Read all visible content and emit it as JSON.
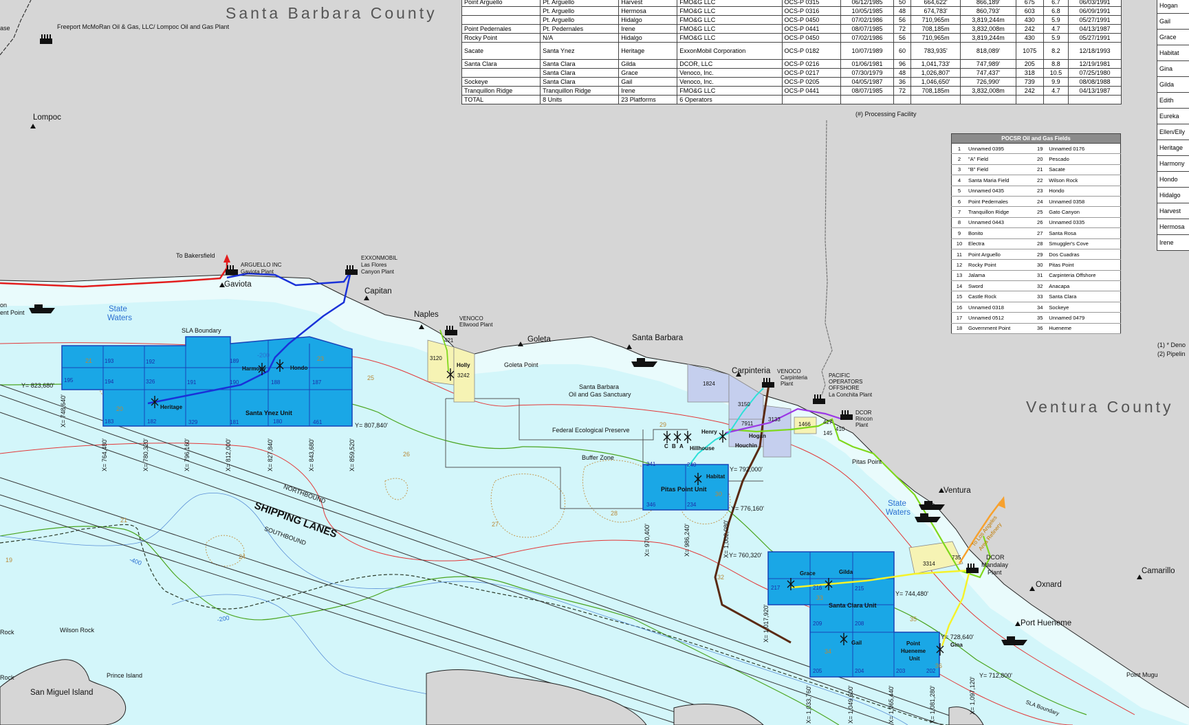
{
  "counties": {
    "santa_barbara": "Santa Barbara County",
    "ventura": "Ventura County"
  },
  "places": {
    "lompoc": "Lompoc",
    "gaviota": "Gaviota",
    "capitan": "Capitan",
    "naples": "Naples",
    "goleta": "Goleta",
    "santa_barbara": "Santa Barbara",
    "carpinteria": "Carpinteria",
    "ventura": "Ventura",
    "oxnard": "Oxnard",
    "camarillo": "Camarillo",
    "port_hueneme": "Port Hueneme",
    "point_mugu": "Point Mugu",
    "pitas_point": "Pitas Point",
    "goleta_point": "Goleta Point",
    "wilson_rock": "Wilson Rock",
    "prince_island": "Prince Island",
    "san_miguel_island": "San Miguel Island",
    "rock": "Rock",
    "conception_point": "ent Point",
    "base": "ase",
    "on": "on"
  },
  "facilities": {
    "freeport_plant": "Freeport McMoRan Oil & Gas, LLC/ Lompoc Oil and Gas Plant",
    "arguello_1": "ARGUELLO INC",
    "arguello_2": "Gaviota Plant",
    "exxon_1": "EXXONMOBIL",
    "exxon_2": "Las Flores",
    "exxon_3": "Canyon Plant",
    "venoco_ellwood_1": "VENOCO",
    "venoco_ellwood_2": "Ellwood Plant",
    "venoco_carp_1": "VENOCO",
    "venoco_carp_2": "Carpinteria",
    "venoco_carp_3": "Plant",
    "pacific_1": "PACIFIC",
    "pacific_2": "OPERATORS",
    "pacific_3": "OFFSHORE",
    "pacific_4": "La Conchita Plant",
    "dcor_rincon_1": "DCOR",
    "dcor_rincon_2": "Rincon",
    "dcor_rincon_3": "Plant",
    "dcor_mandalay_1": "DCOR",
    "dcor_mandalay_2": "Mandalay",
    "dcor_mandalay_3": "Plant",
    "to_bakersfield": "To Bakersfield",
    "to_la_1": "To Los Angeles",
    "to_la_2": "Area Refinery"
  },
  "zones": {
    "state_waters_1": "State",
    "state_waters_2": "Waters",
    "state_waters_b1": "State",
    "state_waters_b2": "Waters",
    "sla_boundary": "SLA Boundary",
    "sla_boundary_2": "SLA Boundary",
    "sanctuary_1": "Santa Barbara",
    "sanctuary_2": "Oil and Gas Sanctuary",
    "federal_preserve": "Federal Ecological Preserve",
    "buffer_zone": "Buffer Zone",
    "shipping_lanes": "SHIPPING LANES",
    "northbound": "NORTHBOUND",
    "southbound": "SOUTHBOUND"
  },
  "units": {
    "santa_ynez": "Santa Ynez Unit",
    "pitas_point": "Pitas Point Unit",
    "santa_clara": "Santa Clara Unit",
    "point_hueneme_1": "Point",
    "point_hueneme_2": "Hueneme",
    "point_hueneme_3": "Unit"
  },
  "platforms": {
    "heritage": "Heritage",
    "harmony": "Harmony",
    "hondo": "Hondo",
    "holly": "Holly",
    "henry": "Henry",
    "hillhouse": "Hillhouse",
    "houchin": "Houchin",
    "hogan": "Hogan",
    "habitat": "Habitat",
    "grace": "Grace",
    "gilda": "Gilda",
    "gail": "Gail",
    "gina": "Gina",
    "c": "C",
    "b": "B",
    "a": "A"
  },
  "tracts": {
    "t195": "195",
    "t193": "193",
    "t192": "192",
    "t194": "194",
    "t326": "326",
    "t191": "191",
    "t189": "189",
    "t190": "190",
    "t188": "188",
    "t187": "187",
    "t183": "183",
    "t182": "182",
    "t329": "329",
    "t181": "181",
    "t180": "180",
    "t461": "461",
    "t3120": "3120",
    "t3242": "3242",
    "t421": "421",
    "t1824": "1824",
    "t3150": "3150",
    "t3133": "3133",
    "t7911": "7911",
    "t1466": "1466",
    "t427": "427",
    "t410": "410",
    "t145": "145",
    "t241": "241",
    "t240": "240",
    "t346": "346",
    "t234": "234",
    "t3314": "3314",
    "t735": "735",
    "t217": "217",
    "t216": "216",
    "t215": "215",
    "t209": "209",
    "t208": "208",
    "t205": "205",
    "t204": "204",
    "t203": "203",
    "t202": "202"
  },
  "fields_nums": {
    "f20": "20",
    "f21": "21",
    "f23": "23",
    "f25": "25",
    "f26": "26",
    "f27": "27",
    "f28": "28",
    "f29": "29",
    "f30": "30",
    "f32": "32",
    "f33": "33",
    "f34": "34",
    "f35": "35",
    "f36": "36",
    "f19": "19",
    "f24": "24",
    "f21b": "21"
  },
  "depths": {
    "d400": "-400",
    "d200": "-200",
    "d200b": "-200"
  },
  "coords": {
    "y823680": "Y= 823,680'",
    "y807840": "Y= 807,840'",
    "y792000": "Y= 792,000'",
    "y776160": "Y= 776,160'",
    "y760320": "Y= 760,320'",
    "y744480": "Y= 744,480'",
    "y728640": "Y= 728,640'",
    "y712800": "Y= 712,800'",
    "x748640": "X= 748,640'",
    "x764480": "X= 764,480'",
    "x780320": "X= 780,320'",
    "x796160": "X= 796,160'",
    "x812000": "X= 812,000'",
    "x827840": "X= 827,840'",
    "x843680": "X= 843,680'",
    "x859520": "X= 859,520'",
    "x970400": "X= 970,400'",
    "x986240": "X= 986,240'",
    "x1002080": "X= 1,002,080'",
    "x1017920": "X= 1,017,920'",
    "x1033760": "X= 1,033,760'",
    "x1049600": "X= 1,049,600'",
    "x1065440": "X= 1,065,440'",
    "x1081280": "X= 1,081,280'",
    "x1097120": "X= 1,097,120'"
  },
  "platform_table": {
    "rows": [
      [
        "Point Arguello",
        "Pt. Arguello",
        "Harvest",
        "FMO&G LLC",
        "OCS-P 0315",
        "06/12/1985",
        "50",
        "664,622'",
        "866,189'",
        "675",
        "6.7",
        "06/03/1991"
      ],
      [
        "",
        "Pt. Arguello",
        "Hermosa",
        "FMO&G LLC",
        "OCS-P 0316",
        "10/05/1985",
        "48",
        "674,783'",
        "860,793'",
        "603",
        "6.8",
        "06/09/1991"
      ],
      [
        "",
        "Pt. Arguello",
        "Hidalgo",
        "FMO&G LLC",
        "OCS-P 0450",
        "07/02/1986",
        "56",
        "710,965m",
        "3,819,244m",
        "430",
        "5.9",
        "05/27/1991"
      ],
      [
        "Point Pedernales",
        "Pt. Pedernales",
        "Irene",
        "FMO&G LLC",
        "OCS-P 0441",
        "08/07/1985",
        "72",
        "708,185m",
        "3,832,008m",
        "242",
        "4.7",
        "04/13/1987"
      ],
      [
        "Rocky Point",
        "N/A",
        "Hidalgo",
        "FMO&G LLC",
        "OCS-P 0450",
        "07/02/1986",
        "56",
        "710,965m",
        "3,819,244m",
        "430",
        "5.9",
        "05/27/1991"
      ],
      [
        "Sacate",
        "Santa Ynez",
        "Heritage",
        "ExxonMobil Corporation",
        "OCS-P 0182",
        "10/07/1989",
        "60",
        "783,935'",
        "818,089'",
        "1075",
        "8.2",
        "12/18/1993"
      ],
      [
        "Santa Clara",
        "Santa Clara",
        "Gilda",
        "DCOR, LLC",
        "OCS-P 0216",
        "01/06/1981",
        "96",
        "1,041,733'",
        "747,989'",
        "205",
        "8.8",
        "12/19/1981"
      ],
      [
        "",
        "Santa Clara",
        "Grace",
        "Venoco, Inc.",
        "OCS-P 0217",
        "07/30/1979",
        "48",
        "1,026,807'",
        "747,437'",
        "318",
        "10.5",
        "07/25/1980"
      ],
      [
        "Sockeye",
        "Santa Clara",
        "Gail",
        "Venoco, Inc.",
        "OCS-P 0205",
        "04/05/1987",
        "36",
        "1,046,650'",
        "726,990'",
        "739",
        "9.9",
        "08/08/1988"
      ],
      [
        "Tranquillon Ridge",
        "Tranquillon Ridge",
        "Irene",
        "FMO&G LLC",
        "OCS-P 0441",
        "08/07/1985",
        "72",
        "708,185m",
        "3,832,008m",
        "242",
        "4.7",
        "04/13/1987"
      ],
      [
        "TOTAL",
        "8 Units",
        "23 Platforms",
        "6 Operators",
        "",
        "",
        "",
        "",
        "",
        "",
        "",
        ""
      ]
    ],
    "footnote": "(#) Processing Facility"
  },
  "fields_table": {
    "title": "POCSR Oil and Gas Fields",
    "rows": [
      [
        "1",
        "Unnamed 0395",
        "19",
        "Unnamed 0176"
      ],
      [
        "2",
        "\"A\" Field",
        "20",
        "Pescado"
      ],
      [
        "3",
        "\"B\" Field",
        "21",
        "Sacate"
      ],
      [
        "4",
        "Santa Maria Field",
        "22",
        "Wilson Rock"
      ],
      [
        "5",
        "Unnamed 0435",
        "23",
        "Hondo"
      ],
      [
        "6",
        "Point Pedernales",
        "24",
        "Unnamed 0358"
      ],
      [
        "7",
        "Tranquillon Ridge",
        "25",
        "Gato Canyon"
      ],
      [
        "8",
        "Unnamed 0443",
        "26",
        "Unnamed 0335"
      ],
      [
        "9",
        "Bonito",
        "27",
        "Santa Rosa"
      ],
      [
        "10",
        "Electra",
        "28",
        "Smuggler's Cove"
      ],
      [
        "11",
        "Point Arguello",
        "29",
        "Dos Cuadras"
      ],
      [
        "12",
        "Rocky Point",
        "30",
        "Pitas Point"
      ],
      [
        "13",
        "Jalama",
        "31",
        "Carpinteria Offshore"
      ],
      [
        "14",
        "Sword",
        "32",
        "Anacapa"
      ],
      [
        "15",
        "Castle Rock",
        "33",
        "Santa Clara"
      ],
      [
        "16",
        "Unnamed 0318",
        "34",
        "Sockeye"
      ],
      [
        "17",
        "Unnamed 0512",
        "35",
        "Unnamed 0479"
      ],
      [
        "18",
        "Government Point",
        "36",
        "Hueneme"
      ]
    ]
  },
  "right_table": {
    "rows": [
      "Hogan",
      "Gail",
      "Grace",
      "Habitat",
      "Gina",
      "Gilda",
      "Edith",
      "Eureka",
      "Ellen/Elly",
      "Heritage",
      "Harmony",
      "Hondo",
      "Hidalgo",
      "Harvest",
      "Hermosa",
      "Irene"
    ],
    "notes": [
      "(1) * Deno",
      "(2) Pipelin"
    ]
  },
  "colors": {
    "land": "#d6d6d6",
    "water": "#d3f6fa",
    "unit_fill": "#1aa7e6",
    "unit_border": "#1844b8",
    "state_waters": "#e9fbfc",
    "oil_pipeline_red": "#e21d1d",
    "gas_pipeline_blue": "#1a32d8",
    "pipeline_brown": "#5a2a12",
    "pipeline_green": "#7fd81c",
    "pipeline_yellow": "#f5f22a",
    "pipeline_purple": "#9b38e6",
    "pipeline_cyan": "#2ee0d8",
    "pipeline_orange": "#f7a12e",
    "sanctuary_tract": "#f6f3b4",
    "carp_tract": "#c5cfee"
  }
}
